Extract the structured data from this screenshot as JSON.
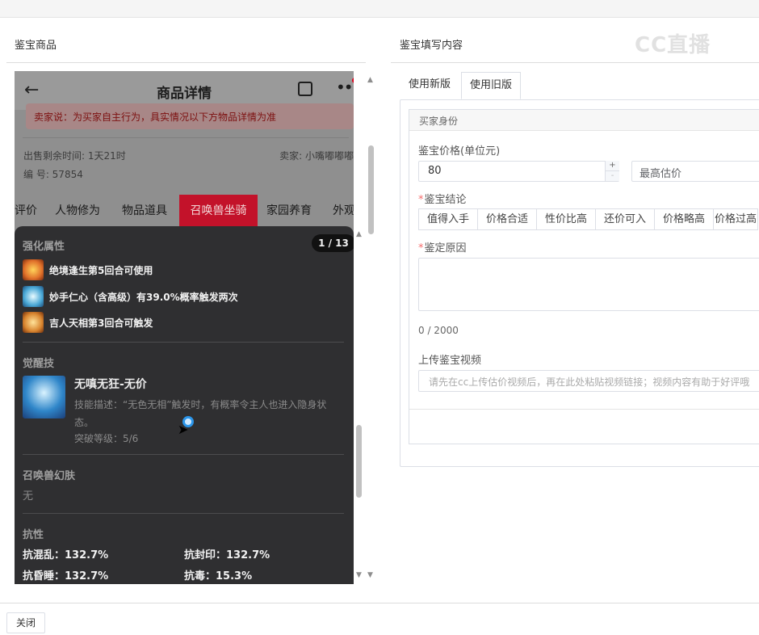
{
  "header": {
    "left_title": "鉴宝商品",
    "right_title": "鉴宝填写内容",
    "watermark": "CC直播"
  },
  "phone": {
    "back_icon": "back-arrow",
    "title": "商品详情",
    "share_icon": "share",
    "more_icon": "more",
    "notice": "卖家说：为买家自主行为，具实情况以下方物品详情为准",
    "remaining_time": "出售剩余时间: 1天21时",
    "serial": "编 号: 57854",
    "seller": "卖家: 小嘴嘟嘟嘟",
    "tabs": [
      "评价",
      "人物修为",
      "物品道具",
      "召唤兽坐骑",
      "家园养育",
      "外观"
    ],
    "active_tab": "召唤兽坐骑",
    "page_badge": "1 / 13",
    "enhance_label": "强化属性",
    "attributes": [
      {
        "text": "绝境逢生第5回合可使用",
        "color": "#e0702a"
      },
      {
        "text": "妙手仁心（含高级）有39.0%概率触发两次",
        "color": "#4aa8d6"
      },
      {
        "text": "吉人天相第3回合可触发",
        "color": "#d8852f"
      }
    ],
    "awaken_label": "觉醒技",
    "skill_name": "无嗔无狂-无价",
    "skill_desc": "技能描述：“无色无相”触发时，有概率令主人也进入隐身状态。",
    "skill_level": "突破等级：5/6",
    "skin_label": "召唤兽幻肤",
    "skin_value": "无",
    "resist_label": "抗性",
    "resists": [
      "抗混乱：132.7%",
      "抗封印：132.7%",
      "抗昏睡：132.7%",
      "抗毒：15.3%"
    ]
  },
  "form": {
    "tabs": [
      "使用新版",
      "使用旧版"
    ],
    "active_tab": "使用旧版",
    "buyer_section": "买家身份",
    "price_label": "鉴宝价格(单位元)",
    "price_value": "80",
    "estimate_placeholder": "最高估价",
    "conclusion_label": "鉴宝结论",
    "conclusions": [
      "值得入手",
      "价格合适",
      "性价比高",
      "还价可入",
      "价格略高",
      "价格过高"
    ],
    "reason_label": "鉴定原因",
    "reason_count": "0 / 2000",
    "video_label": "上传鉴宝视频",
    "video_placeholder": "请先在cc上传估价视频后，再在此处粘贴视频链接；视频内容有助于好评哦"
  },
  "footer": {
    "close_label": "关闭"
  },
  "colors": {
    "active_tab_bg": "#c3122a",
    "dark_panel": "#2f2f31",
    "required": "#f56c6c"
  }
}
